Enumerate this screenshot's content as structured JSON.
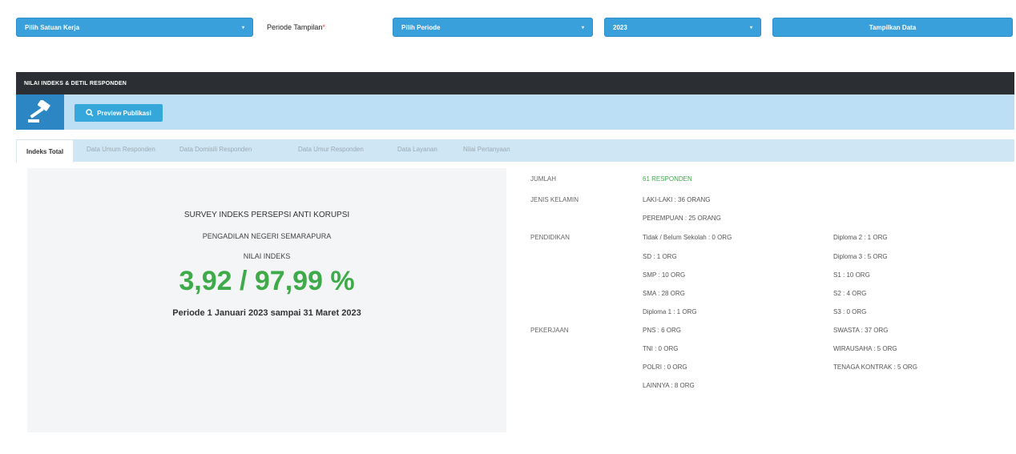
{
  "filters": {
    "satuan_kerja_placeholder": "Pilih Satuan Kerja",
    "periode_label": "Periode Tampilan",
    "periode_required": "*",
    "periode_select": "Pilih Periode",
    "tahun_select": "2023",
    "tampilkan_label": "Tampilkan Data",
    "caret": "▾"
  },
  "panel": {
    "title": "NILAI INDEKS & DETIL RESPONDEN",
    "preview_label": "Preview Publikasi"
  },
  "tabs": [
    {
      "label": "Indeks Total"
    },
    {
      "label": "Data Umum Responden"
    },
    {
      "label": "Data Domisili Responden"
    },
    {
      "label": "Data Umur Responden"
    },
    {
      "label": "Data Layanan"
    },
    {
      "label": "Nilai Pertanyaan"
    }
  ],
  "summary": {
    "survey_title": "SURVEY INDEKS PERSEPSI ANTI KORUPSI",
    "instansi": "PENGADILAN NEGERI SEMARAPURA",
    "nilai_label": "NILAI INDEKS",
    "nilai": "3,92 / 97,99 %",
    "periode": "Periode 1 Januari 2023 sampai 31 Maret 2023"
  },
  "details": {
    "jumlah_label": "JUMLAH",
    "jumlah_value": "61 RESPONDEN",
    "jenis_kelamin_label": "JENIS KELAMIN",
    "laki": "LAKI-LAKI : 36 ORANG",
    "perempuan": "PEREMPUAN : 25 ORANG",
    "pendidikan_label": "PENDIDIKAN",
    "pendidikan_col1": [
      "Tidak / Belum Sekolah : 0 ORG",
      "SD : 1 ORG",
      "SMP : 10 ORG",
      "SMA : 28 ORG",
      "Diploma 1 : 1 ORG"
    ],
    "pendidikan_col2": [
      "Diploma 2 : 1 ORG",
      "Diploma 3 : 5 ORG",
      "S1 : 10 ORG",
      "S2 : 4 ORG",
      "S3 : 0 ORG"
    ],
    "pekerjaan_label": "PEKERJAAN",
    "pekerjaan_col1": [
      "PNS : 6 ORG",
      "TNI : 0 ORG",
      "POLRI : 0 ORG",
      "LAINNYA : 8 ORG"
    ],
    "pekerjaan_col2": [
      "SWASTA : 37 ORG",
      "WIRAUSAHA : 5 ORG",
      "TENAGA KONTRAK : 5 ORG"
    ]
  }
}
